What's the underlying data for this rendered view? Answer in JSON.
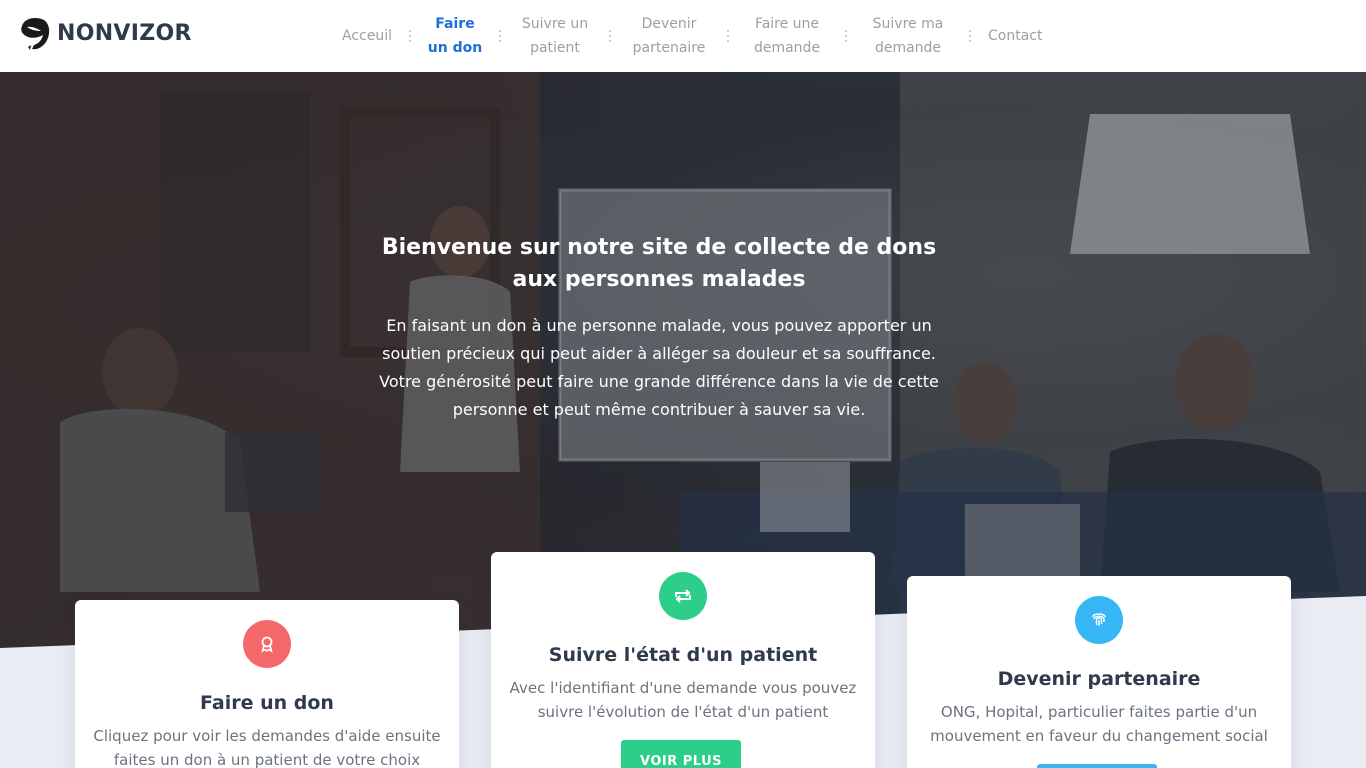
{
  "brand": {
    "name": "NONVIZOR",
    "logo_icon": "bird-leaf-logo-icon"
  },
  "nav": {
    "items": [
      {
        "label": "Acceuil"
      },
      {
        "label": "Faire un don",
        "active": true
      },
      {
        "label": "Suivre un patient"
      },
      {
        "label": "Devenir partenaire"
      },
      {
        "label": "Faire une demande"
      },
      {
        "label": "Suivre ma demande"
      },
      {
        "label": "Contact"
      }
    ],
    "active_color": "#1f6fd6"
  },
  "hero": {
    "title": "Bienvenue sur notre site de collecte de dons aux personnes malades",
    "text": "En faisant un don à une personne malade, vous pouvez apporter un soutien précieux qui peut aider à alléger sa douleur et sa souffrance. Votre générosité peut faire une grande différence dans la vie de cette personne et peut même contribuer à sauver sa vie."
  },
  "cards": [
    {
      "title": "Faire un don",
      "text": "Cliquez pour voir les demandes d'aide ensuite faites un don à un patient de votre choix",
      "icon": "award-ribbon-icon",
      "icon_color": "#f5686a"
    },
    {
      "title": "Suivre l'état d'un patient",
      "text": "Avec l'identifiant d'une demande vous pouvez suivre l'évolution de l'état d'un patient",
      "icon": "repeat-arrows-icon",
      "icon_color": "#2dce89",
      "button": "VOIR PLUS",
      "button_color": "#2dce89"
    },
    {
      "title": "Devenir partenaire",
      "text": "ONG, Hopital, particulier faites partie d'un mouvement en faveur du changement social",
      "icon": "fingerprint-icon",
      "icon_color": "#37b6f6",
      "button_color": "#37b6f6"
    }
  ]
}
